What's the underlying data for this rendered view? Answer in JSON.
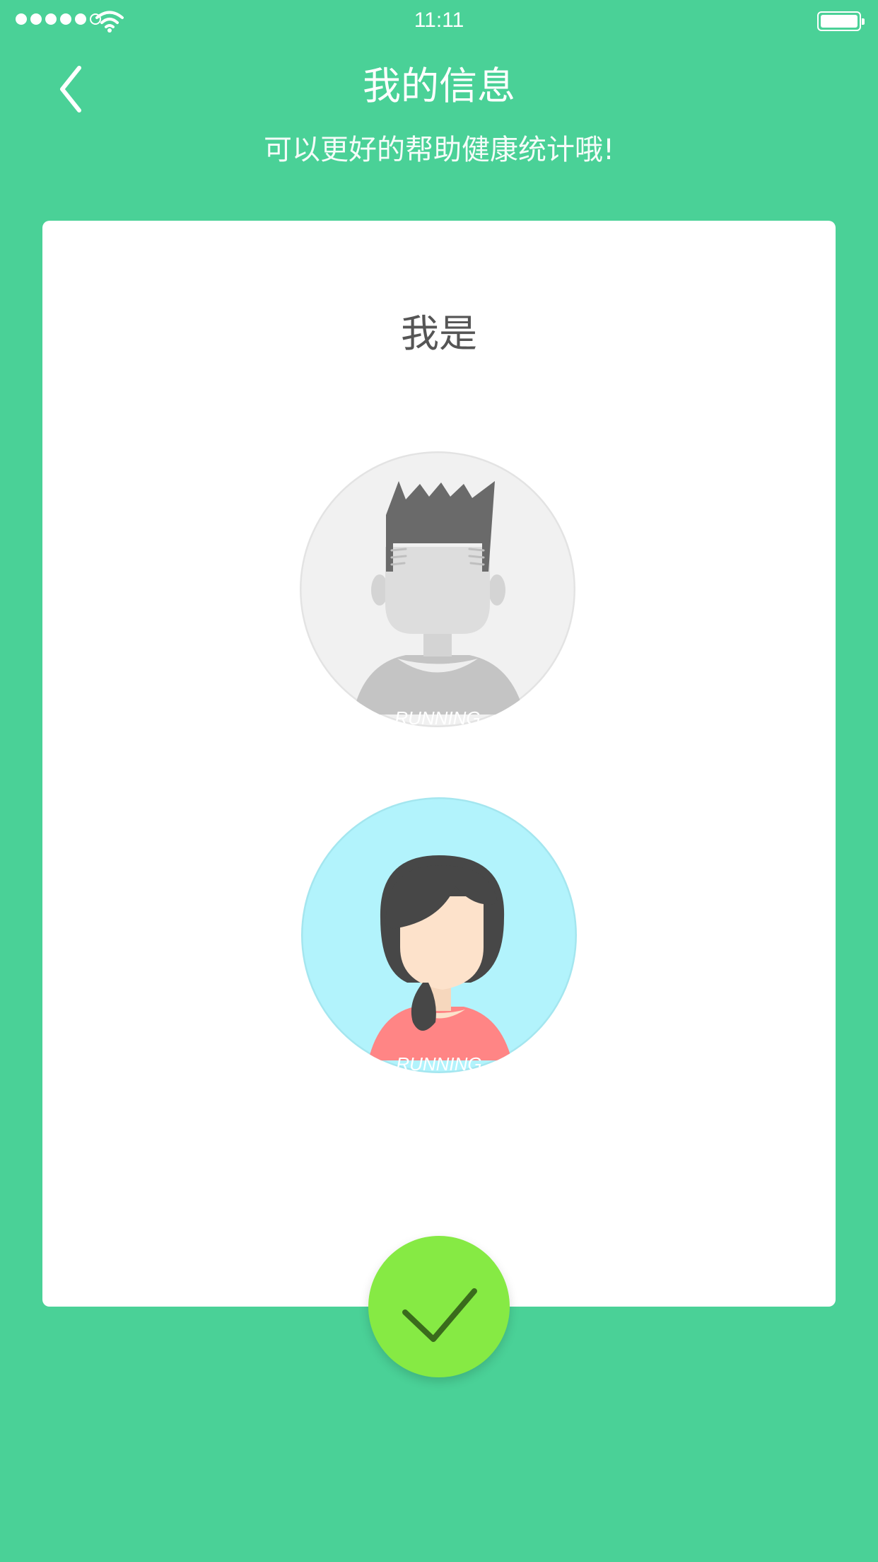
{
  "status_bar": {
    "time": "11:11",
    "signal_bars_filled": 5,
    "signal_bars_total": 6
  },
  "header": {
    "back_icon": "chevron-left-icon",
    "title": "我的信息",
    "subtitle": "可以更好的帮助健康统计哦!"
  },
  "card": {
    "question": "我是",
    "options": [
      {
        "id": "male",
        "shirt_text": "RUNNING",
        "selected": false,
        "bg_color": "#f1f1f1"
      },
      {
        "id": "female",
        "shirt_text": "RUNNING",
        "selected": true,
        "bg_color": "#b2f3fc"
      }
    ]
  },
  "confirm": {
    "icon": "checkmark-icon"
  },
  "colors": {
    "background": "#4ad197",
    "card": "#ffffff",
    "confirm": "#86ea44",
    "check": "#3a6b1c"
  }
}
